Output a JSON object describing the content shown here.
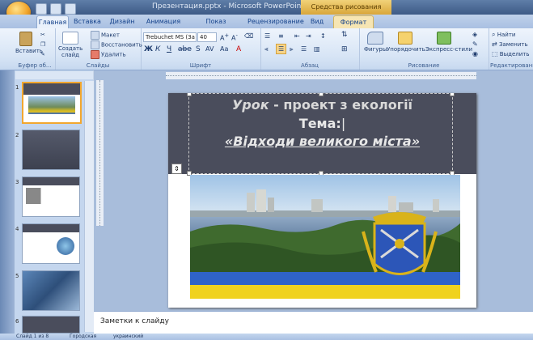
{
  "window": {
    "title": "Презентация.pptx - Microsoft PowerPoint",
    "context_header": "Средства рисования"
  },
  "tabs": [
    {
      "label": "Главная"
    },
    {
      "label": "Вставка"
    },
    {
      "label": "Дизайн"
    },
    {
      "label": "Анимация"
    },
    {
      "label": "Показ слайдов"
    },
    {
      "label": "Рецензирование"
    },
    {
      "label": "Вид"
    },
    {
      "label": "Формат"
    }
  ],
  "ribbon": {
    "clipboard": {
      "paste": "Вставить",
      "label": "Буфер об..."
    },
    "slides": {
      "create": "Создать слайд",
      "layout": "Макет",
      "reset": "Восстановить",
      "delete": "Удалить",
      "label": "Слайды"
    },
    "font": {
      "name": "Trebuchet MS (За",
      "size": "40",
      "label": "Шрифт"
    },
    "paragraph": {
      "label": "Абзац"
    },
    "drawing": {
      "shapes": "Фигуры",
      "arrange": "Упорядочить",
      "quick_styles": "Экспресс-стили",
      "label": "Рисование"
    },
    "editing": {
      "find": "Найти",
      "replace": "Заменить",
      "select": "Выделить",
      "label": "Редактирование"
    }
  },
  "slides": [
    {
      "num": "1"
    },
    {
      "num": "2"
    },
    {
      "num": "3"
    },
    {
      "num": "4"
    },
    {
      "num": "5"
    },
    {
      "num": "6"
    }
  ],
  "slide": {
    "line1_italic": "Урок",
    "line1_rest": " - проект  з екології",
    "line2": "Тема:",
    "line3": "«Відходи великого міста»"
  },
  "notes": {
    "placeholder": "Заметки к слайду"
  },
  "status": {
    "slide_info": "Слайд 1 из 8",
    "theme": "Городская",
    "language": "украинский"
  },
  "colors": {
    "ribbon_bg": "#d6e4f5",
    "accent_orange": "#f2a72e",
    "slide_header": "#4a4d5c"
  }
}
